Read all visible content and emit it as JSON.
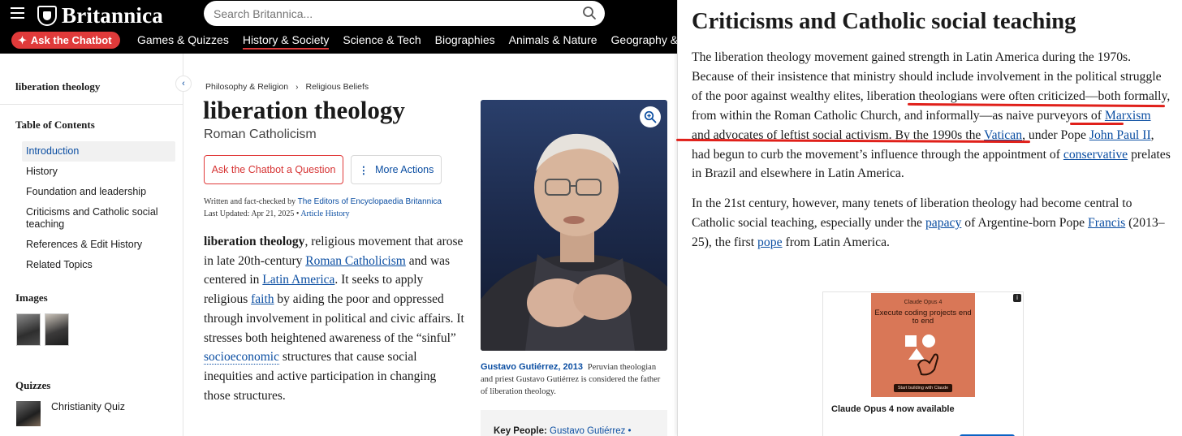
{
  "header": {
    "logo_text": "Britannica",
    "search_placeholder": "Search Britannica...",
    "chatbot_label": "Ask the Chatbot",
    "nav": [
      {
        "label": "Games & Quizzes",
        "active": false
      },
      {
        "label": "History & Society",
        "active": true
      },
      {
        "label": "Science & Tech",
        "active": false
      },
      {
        "label": "Biographies",
        "active": false
      },
      {
        "label": "Animals & Nature",
        "active": false
      },
      {
        "label": "Geography & Travel",
        "active": false
      }
    ]
  },
  "sidebar": {
    "topic": "liberation theology",
    "collapse_icon": "chevron-left-icon",
    "toc_heading": "Table of Contents",
    "toc": [
      {
        "label": "Introduction",
        "active": true
      },
      {
        "label": "History",
        "active": false
      },
      {
        "label": "Foundation and leadership",
        "active": false
      },
      {
        "label": "Criticisms and Catholic social teaching",
        "active": false
      },
      {
        "label": "References & Edit History",
        "active": false
      },
      {
        "label": "Related Topics",
        "active": false
      }
    ],
    "images_heading": "Images",
    "quizzes_heading": "Quizzes",
    "quiz_label": "Christianity Quiz"
  },
  "article": {
    "breadcrumb": [
      "Philosophy & Religion",
      "Religious Beliefs"
    ],
    "title": "liberation theology",
    "subtitle": "Roman Catholicism",
    "ask_button": "Ask the Chatbot a Question",
    "more_button": "More Actions",
    "byline_prefix": "Written and fact-checked by",
    "byline_author": "The Editors of Encyclopaedia Britannica",
    "last_updated": "Last Updated: Apr 21, 2025",
    "history_link": "Article History",
    "body": {
      "term": "liberation theology",
      "t1": ", religious movement that arose in late 20th-century ",
      "l1": "Roman Catholicism",
      "t2": " and was centered in ",
      "l2": "Latin America",
      "t3": ". It seeks to apply religious ",
      "l3": "faith",
      "t4": " by aiding the poor and oppressed through involvement in political and civic affairs. It stresses both heightened awareness of the “sinful” ",
      "l4": "socioeconomic",
      "t5": " structures that cause social inequities and active participation in changing those structures."
    },
    "caption_name": "Gustavo Gutiérrez, 2013",
    "caption_text": "Peruvian theologian and priest Gustavo Gutiérrez is considered the father of liberation theology.",
    "key_people_label": "Key People:",
    "key_people_value": "Gustavo Gutiérrez •"
  },
  "panel": {
    "heading": "Criticisms and Catholic social teaching",
    "p1": {
      "a": "The liberation theology movement gained strength in Latin America during the 1970s. Because of their insistence that ministry should include involvement in the political struggle of the poor against wealthy elites, liberation theologians were often criticized—both formally, from within the Roman Catholic Church, and informally—as naive purveyors of ",
      "l1": "Marxism",
      "b": " and advocates of leftist social activism. By the 1990s the ",
      "l2": "Vatican",
      "c": ", under Pope ",
      "l3": "John Paul II",
      "d": ", had begun to curb the movement’s influence through the appointment of ",
      "l4": "conservative",
      "e": " prelates in Brazil and elsewhere in Latin America."
    },
    "p2": {
      "a": "In the 21st century, however, many tenets of liberation theology had become central to Catholic social teaching, especially under the ",
      "l1": "papacy",
      "b": " of Argentine-born Pope ",
      "l2": "Francis",
      "c": " (2013–25), the first ",
      "l3": "pope",
      "d": " from Latin America."
    },
    "ad": {
      "brand": "Claude Opus 4",
      "tagline": "Execute coding projects end to end",
      "cta": "Start building with Claude",
      "title": "Claude Opus 4 now available"
    }
  },
  "colors": {
    "accent_red": "#e03a3a",
    "link_blue": "#0b4ea2",
    "annotation_red": "#e0201a",
    "ad_orange": "#d97757"
  }
}
